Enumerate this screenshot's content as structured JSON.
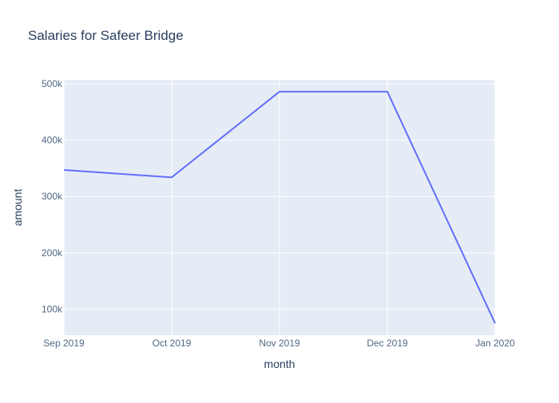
{
  "chart_data": {
    "type": "line",
    "title": "Salaries for Safeer Bridge",
    "xlabel": "month",
    "ylabel": "amount",
    "x": [
      "2019-09-01",
      "2019-10-01",
      "2019-11-01",
      "2019-12-01",
      "2020-01-01"
    ],
    "x_tick_labels": [
      "Sep 2019",
      "Oct 2019",
      "Nov 2019",
      "Dec 2019",
      "Jan 2020"
    ],
    "series": [
      {
        "values": [
          347000,
          334000,
          486000,
          486000,
          75000
        ]
      }
    ],
    "ylim": [
      54000,
      507000
    ],
    "y_ticks": [
      100000,
      200000,
      300000,
      400000,
      500000
    ],
    "y_tick_labels": [
      "100k",
      "200k",
      "300k",
      "400k",
      "500k"
    ],
    "grid": true,
    "legend": false,
    "colors": {
      "line": "#636efa",
      "plot_bg": "#e5ecf6",
      "grid": "#ffffff",
      "text": "#2a3f5f",
      "tick_text": "#506784"
    }
  }
}
